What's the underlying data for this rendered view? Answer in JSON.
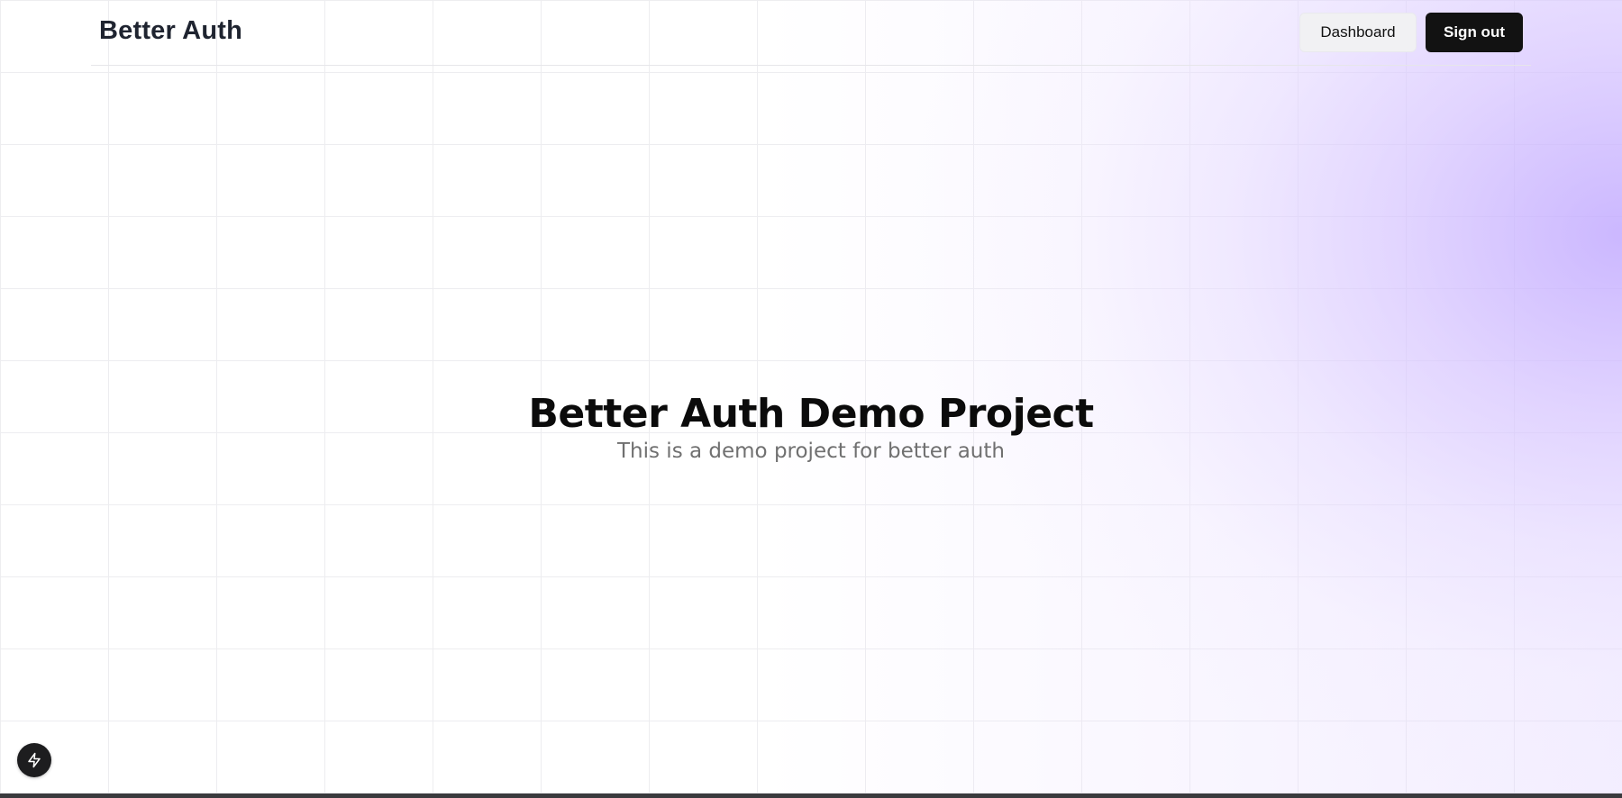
{
  "header": {
    "brand": "Better Auth",
    "dashboard_label": "Dashboard",
    "signout_label": "Sign out"
  },
  "hero": {
    "title": "Better Auth Demo Project",
    "subtitle": "This is a demo project for better auth"
  },
  "fab": {
    "icon": "lightning-icon"
  },
  "colors": {
    "accent_gradient": "#d7c8ff",
    "primary_button": "#121212",
    "secondary_button": "#f1f1f3",
    "brand_text": "#1f2430",
    "subtitle_text": "#707070"
  }
}
